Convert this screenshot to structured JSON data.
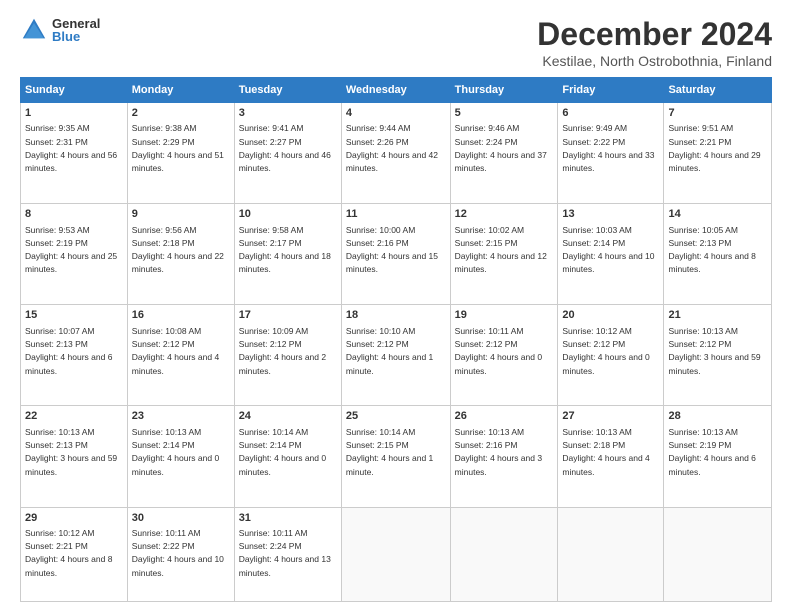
{
  "logo": {
    "general": "General",
    "blue": "Blue"
  },
  "title": "December 2024",
  "subtitle": "Kestilae, North Ostrobothnia, Finland",
  "calendar": {
    "headers": [
      "Sunday",
      "Monday",
      "Tuesday",
      "Wednesday",
      "Thursday",
      "Friday",
      "Saturday"
    ],
    "weeks": [
      [
        {
          "day": "1",
          "rise": "9:35 AM",
          "set": "2:31 PM",
          "daylight": "4 hours and 56 minutes."
        },
        {
          "day": "2",
          "rise": "9:38 AM",
          "set": "2:29 PM",
          "daylight": "4 hours and 51 minutes."
        },
        {
          "day": "3",
          "rise": "9:41 AM",
          "set": "2:27 PM",
          "daylight": "4 hours and 46 minutes."
        },
        {
          "day": "4",
          "rise": "9:44 AM",
          "set": "2:26 PM",
          "daylight": "4 hours and 42 minutes."
        },
        {
          "day": "5",
          "rise": "9:46 AM",
          "set": "2:24 PM",
          "daylight": "4 hours and 37 minutes."
        },
        {
          "day": "6",
          "rise": "9:49 AM",
          "set": "2:22 PM",
          "daylight": "4 hours and 33 minutes."
        },
        {
          "day": "7",
          "rise": "9:51 AM",
          "set": "2:21 PM",
          "daylight": "4 hours and 29 minutes."
        }
      ],
      [
        {
          "day": "8",
          "rise": "9:53 AM",
          "set": "2:19 PM",
          "daylight": "4 hours and 25 minutes."
        },
        {
          "day": "9",
          "rise": "9:56 AM",
          "set": "2:18 PM",
          "daylight": "4 hours and 22 minutes."
        },
        {
          "day": "10",
          "rise": "9:58 AM",
          "set": "2:17 PM",
          "daylight": "4 hours and 18 minutes."
        },
        {
          "day": "11",
          "rise": "10:00 AM",
          "set": "2:16 PM",
          "daylight": "4 hours and 15 minutes."
        },
        {
          "day": "12",
          "rise": "10:02 AM",
          "set": "2:15 PM",
          "daylight": "4 hours and 12 minutes."
        },
        {
          "day": "13",
          "rise": "10:03 AM",
          "set": "2:14 PM",
          "daylight": "4 hours and 10 minutes."
        },
        {
          "day": "14",
          "rise": "10:05 AM",
          "set": "2:13 PM",
          "daylight": "4 hours and 8 minutes."
        }
      ],
      [
        {
          "day": "15",
          "rise": "10:07 AM",
          "set": "2:13 PM",
          "daylight": "4 hours and 6 minutes."
        },
        {
          "day": "16",
          "rise": "10:08 AM",
          "set": "2:12 PM",
          "daylight": "4 hours and 4 minutes."
        },
        {
          "day": "17",
          "rise": "10:09 AM",
          "set": "2:12 PM",
          "daylight": "4 hours and 2 minutes."
        },
        {
          "day": "18",
          "rise": "10:10 AM",
          "set": "2:12 PM",
          "daylight": "4 hours and 1 minute."
        },
        {
          "day": "19",
          "rise": "10:11 AM",
          "set": "2:12 PM",
          "daylight": "4 hours and 0 minutes."
        },
        {
          "day": "20",
          "rise": "10:12 AM",
          "set": "2:12 PM",
          "daylight": "4 hours and 0 minutes."
        },
        {
          "day": "21",
          "rise": "10:13 AM",
          "set": "2:12 PM",
          "daylight": "3 hours and 59 minutes."
        }
      ],
      [
        {
          "day": "22",
          "rise": "10:13 AM",
          "set": "2:13 PM",
          "daylight": "3 hours and 59 minutes."
        },
        {
          "day": "23",
          "rise": "10:13 AM",
          "set": "2:14 PM",
          "daylight": "4 hours and 0 minutes."
        },
        {
          "day": "24",
          "rise": "10:14 AM",
          "set": "2:14 PM",
          "daylight": "4 hours and 0 minutes."
        },
        {
          "day": "25",
          "rise": "10:14 AM",
          "set": "2:15 PM",
          "daylight": "4 hours and 1 minute."
        },
        {
          "day": "26",
          "rise": "10:13 AM",
          "set": "2:16 PM",
          "daylight": "4 hours and 3 minutes."
        },
        {
          "day": "27",
          "rise": "10:13 AM",
          "set": "2:18 PM",
          "daylight": "4 hours and 4 minutes."
        },
        {
          "day": "28",
          "rise": "10:13 AM",
          "set": "2:19 PM",
          "daylight": "4 hours and 6 minutes."
        }
      ],
      [
        {
          "day": "29",
          "rise": "10:12 AM",
          "set": "2:21 PM",
          "daylight": "4 hours and 8 minutes."
        },
        {
          "day": "30",
          "rise": "10:11 AM",
          "set": "2:22 PM",
          "daylight": "4 hours and 10 minutes."
        },
        {
          "day": "31",
          "rise": "10:11 AM",
          "set": "2:24 PM",
          "daylight": "4 hours and 13 minutes."
        },
        null,
        null,
        null,
        null
      ]
    ]
  }
}
